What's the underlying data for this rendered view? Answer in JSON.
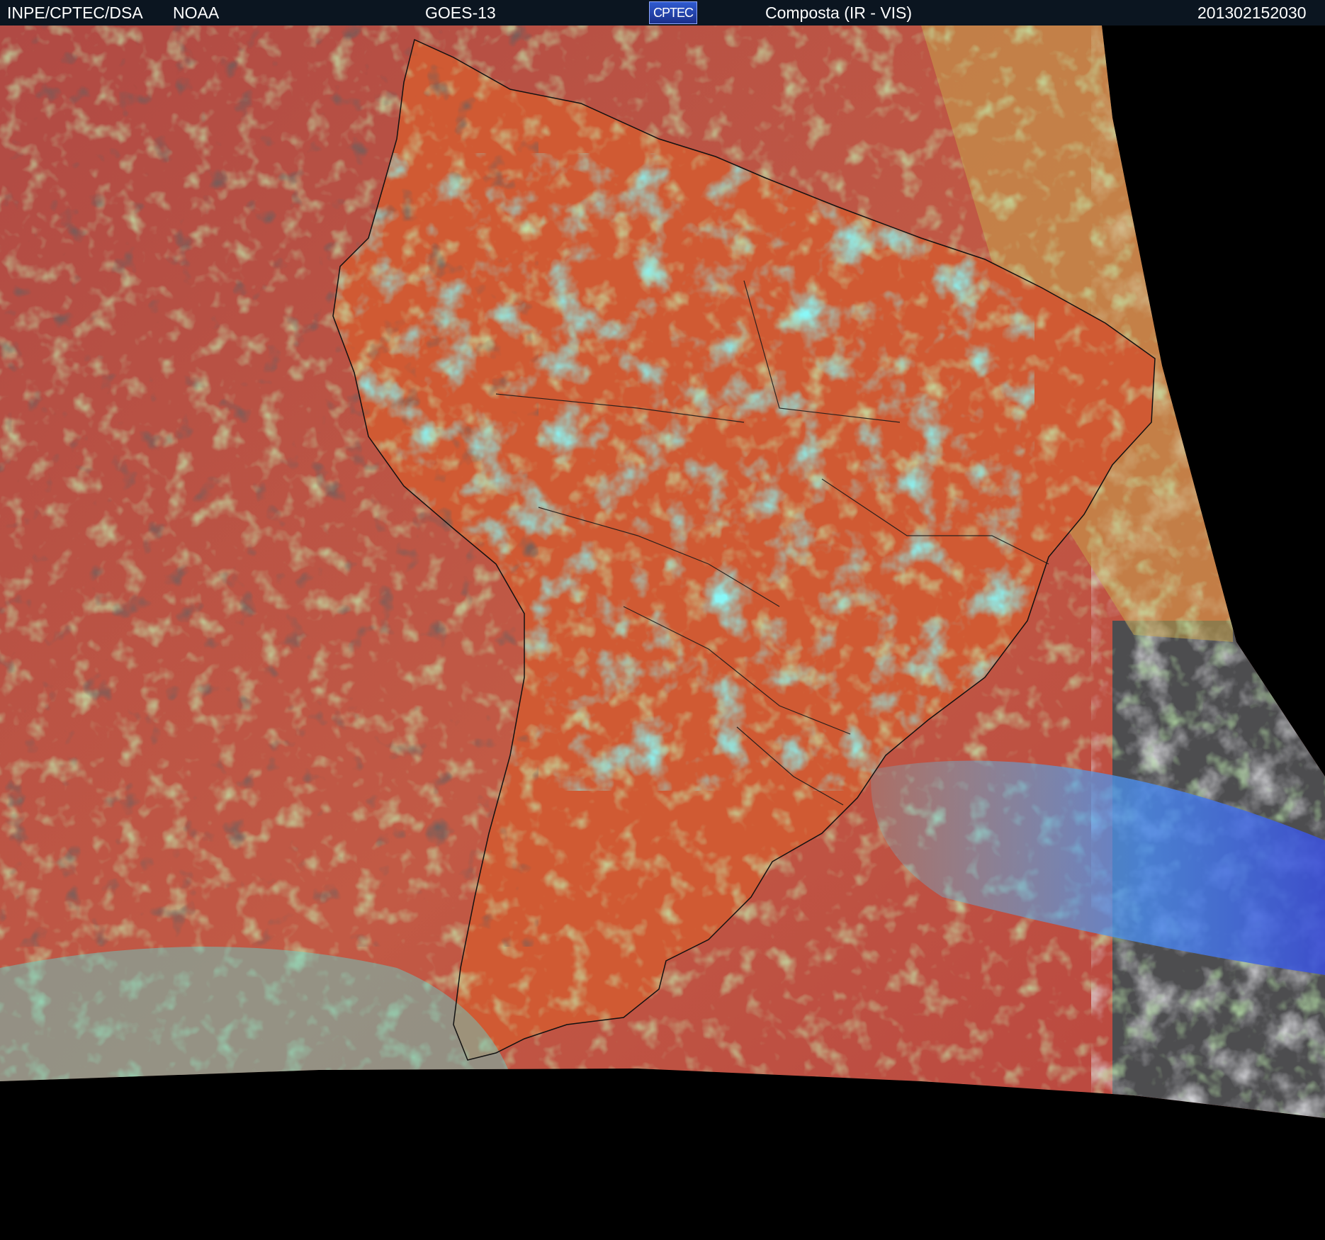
{
  "header": {
    "institution": "INPE/CPTEC/DSA",
    "agency": "NOAA",
    "satellite": "GOES-13",
    "logo_text": "CPTEC",
    "product": "Composta (IR - VIS)",
    "timestamp": "201302152030"
  },
  "colors": {
    "header_bg": "#0b1520",
    "ocean_clear": "#b5483f",
    "land_clear": "#d9602a",
    "low_cloud": "#8ee07a",
    "high_cloud": "#3ff0f0",
    "cold_cloud_blue": "#4a6ef0",
    "visible_gray": "#5a5a5a",
    "space_black": "#000000",
    "coastline": "#111111"
  }
}
